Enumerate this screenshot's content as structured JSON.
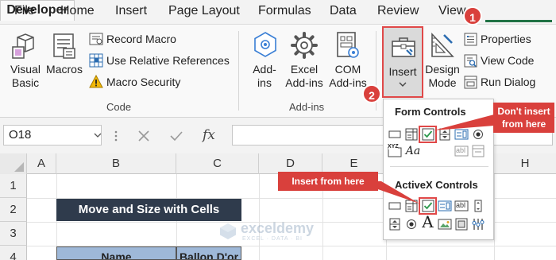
{
  "tabs": [
    "File",
    "Home",
    "Insert",
    "Page Layout",
    "Formulas",
    "Data",
    "Review",
    "View",
    "Developer"
  ],
  "active_tab": "Developer",
  "ribbon": {
    "code": {
      "visual_basic": [
        "Visual",
        "Basic"
      ],
      "macros": "Macros",
      "record_macro": "Record Macro",
      "use_relative_references": "Use Relative References",
      "macro_security": "Macro Security",
      "group_label": "Code"
    },
    "addins": {
      "addins": [
        "Add-",
        "ins"
      ],
      "excel_addins": [
        "Excel",
        "Add-ins"
      ],
      "com_addins": [
        "COM",
        "Add-ins"
      ],
      "group_label": "Add-ins"
    },
    "controls": {
      "insert": "Insert",
      "design_mode": [
        "Design",
        "Mode"
      ],
      "properties": "Properties",
      "view_code": "View Code",
      "run_dialog": "Run Dialog"
    }
  },
  "formula_bar": {
    "name_box": "O18",
    "fx_label": "fx",
    "formula": ""
  },
  "columns": [
    "A",
    "B",
    "C",
    "D",
    "E",
    "H"
  ],
  "rows": [
    "1",
    "2",
    "3",
    "4"
  ],
  "cells": {
    "title": "Move and Size with Cells",
    "header_name": "Name",
    "header_ballon": "Ballon D'or"
  },
  "dropdown": {
    "form_controls_heading": "Form Controls",
    "activex_controls_heading": "ActiveX Controls",
    "aa_label": "Aa",
    "ab_label": "abl",
    "xyz_label": "XYZ",
    "activex_a_label": "A"
  },
  "callouts": {
    "badge_1": "1",
    "badge_2": "2",
    "dont_insert": [
      "Don't insert",
      "from here"
    ],
    "insert_from_here": "Insert from here"
  },
  "watermark": {
    "brand": "exceldemy",
    "tagline": "EXCEL · DATA · BI"
  },
  "colors": {
    "accent_green": "#217346",
    "highlight_red": "#e04848",
    "callout_red": "#d9403c",
    "title_fill": "#2f3b4c",
    "header_fill": "#9eb8d8"
  }
}
